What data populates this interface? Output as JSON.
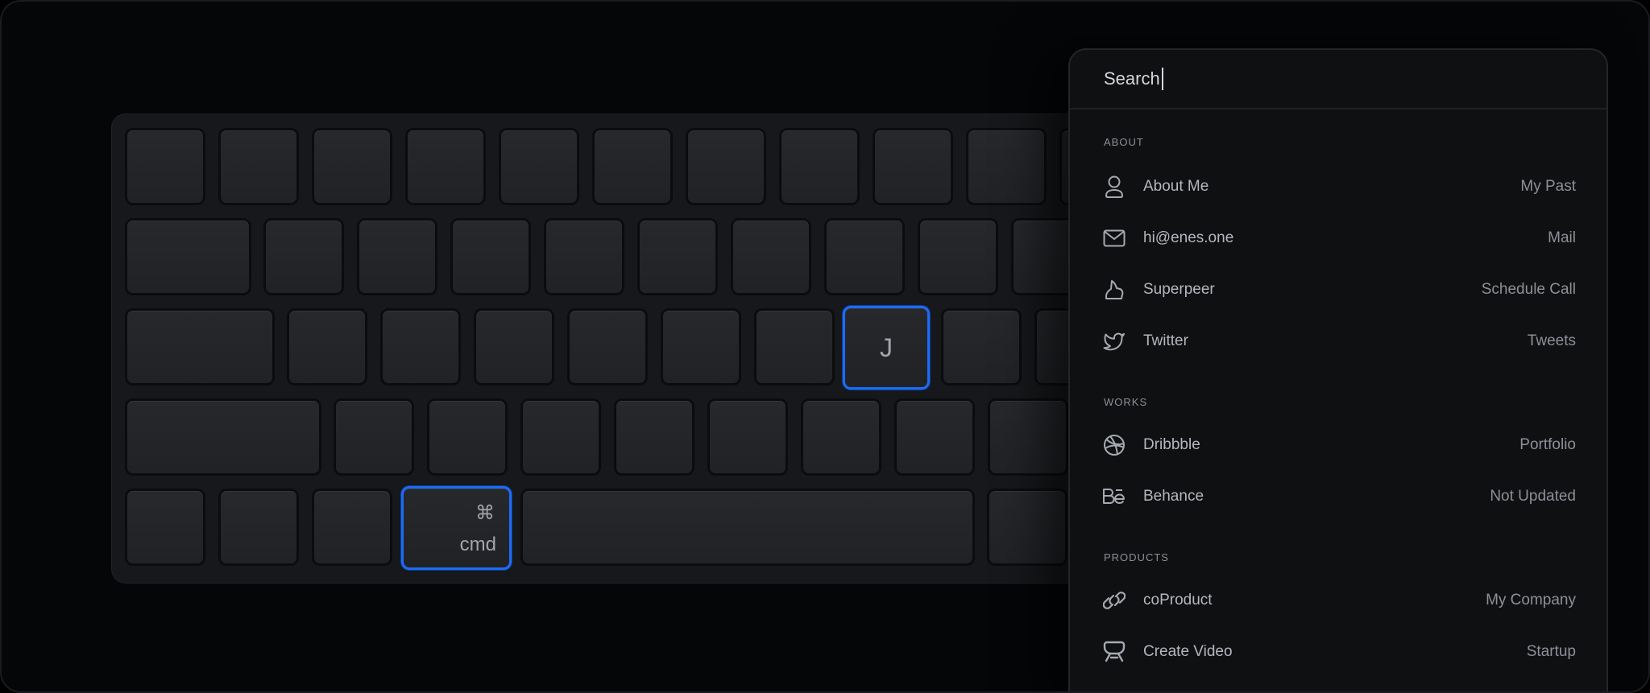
{
  "keyboard": {
    "j_key": "J",
    "cmd_key": {
      "symbol": "⌘",
      "label": "cmd"
    }
  },
  "palette": {
    "search": {
      "value": "Search"
    },
    "sections": [
      {
        "title": "ABOUT",
        "items": [
          {
            "icon": "user-icon",
            "label": "About Me",
            "hint": "My Past"
          },
          {
            "icon": "mail-icon",
            "label": "hi@enes.one",
            "hint": "Mail"
          },
          {
            "icon": "superpeer-icon",
            "label": "Superpeer",
            "hint": "Schedule Call"
          },
          {
            "icon": "twitter-icon",
            "label": "Twitter",
            "hint": "Tweets"
          }
        ]
      },
      {
        "title": "WORKS",
        "items": [
          {
            "icon": "dribbble-icon",
            "label": "Dribbble",
            "hint": "Portfolio"
          },
          {
            "icon": "behance-icon",
            "label": "Behance",
            "hint": "Not Updated"
          }
        ]
      },
      {
        "title": "PRODUCTS",
        "items": [
          {
            "icon": "coproduct-icon",
            "label": "coProduct",
            "hint": "My Company"
          },
          {
            "icon": "create-video-icon",
            "label": "Create Video",
            "hint": "Startup"
          }
        ]
      }
    ]
  },
  "colors": {
    "accent": "#1d6cf2",
    "background": "#050608",
    "panel": "#0f1012",
    "key": "#242529"
  }
}
